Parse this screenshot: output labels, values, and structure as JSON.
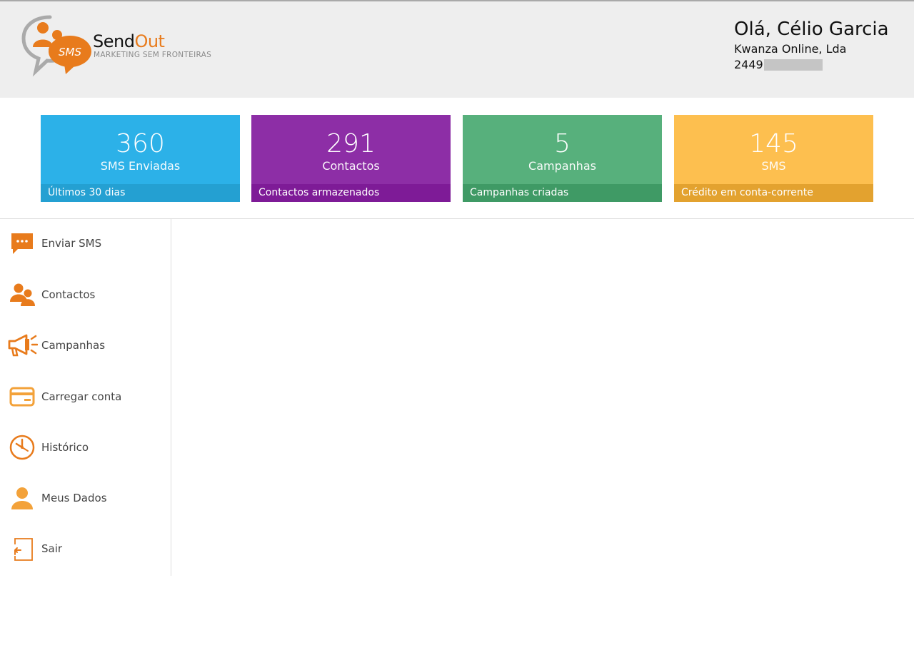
{
  "brand": {
    "name_part1": "Send",
    "name_part2": "Out",
    "bubble_text": "SMS",
    "tagline": "MARKETING SEM FRONTEIRAS",
    "accent_color": "#e87b1c"
  },
  "user": {
    "greeting": "Olá, Célio Garcia",
    "company": "Kwanza Online, Lda",
    "phone_visible": "2449"
  },
  "cards": [
    {
      "value": "360",
      "label": "SMS Enviadas",
      "footer": "Últimos 30 dias",
      "color": "#2cb1e8",
      "footer_color": "#24a0d2"
    },
    {
      "value": "291",
      "label": "Contactos",
      "footer": "Contactos armazenados",
      "color": "#8d2ea6",
      "footer_color": "#7e1b97"
    },
    {
      "value": "5",
      "label": "Campanhas",
      "footer": "Campanhas criadas",
      "color": "#57b07c",
      "footer_color": "#3f9a65"
    },
    {
      "value": "145",
      "label": "SMS",
      "footer": "Crédito em conta-corrente",
      "color": "#fdbf4f",
      "footer_color": "#e3a22f"
    }
  ],
  "nav": [
    {
      "label": "Enviar SMS",
      "icon": "chat-bubble-icon"
    },
    {
      "label": "Contactos",
      "icon": "users-icon"
    },
    {
      "label": "Campanhas",
      "icon": "megaphone-icon"
    },
    {
      "label": "Carregar conta",
      "icon": "credit-card-icon"
    },
    {
      "label": "Histórico",
      "icon": "clock-icon"
    },
    {
      "label": "Meus Dados",
      "icon": "user-icon"
    },
    {
      "label": "Sair",
      "icon": "exit-icon"
    }
  ]
}
